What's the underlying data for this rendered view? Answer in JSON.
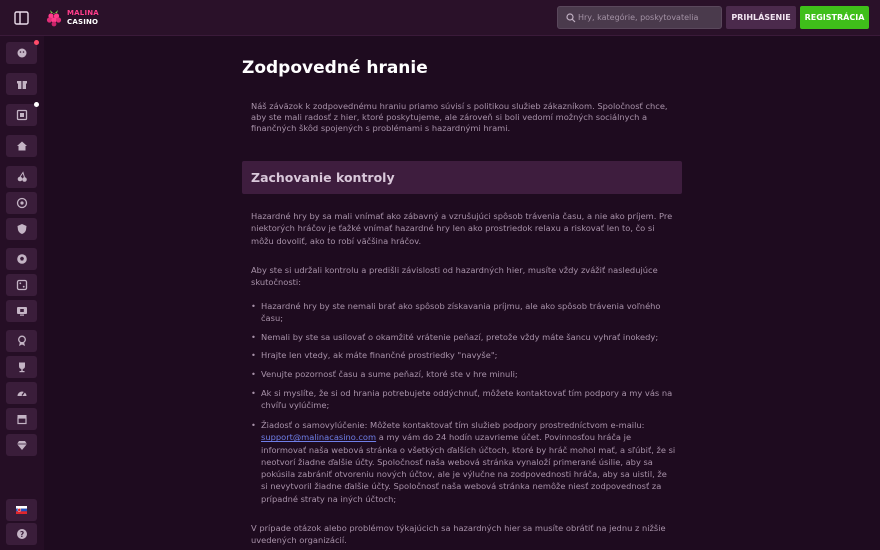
{
  "header": {
    "logo_line1": "MALINA",
    "logo_line2": "CASINO",
    "search_placeholder": "Hry, kategórie, poskytovatelia",
    "login_label": "PRIHLÁSENIE",
    "register_label": "REGISTRÁCIA"
  },
  "sidebar": {
    "items": [
      {
        "icon": "avatar-icon",
        "badge": "red"
      },
      {
        "icon": "gift-icon"
      },
      {
        "icon": "slot-machine-icon",
        "badge": "white"
      },
      {
        "icon": "home-icon"
      },
      {
        "icon": "cherries-icon"
      },
      {
        "icon": "roulette-icon"
      },
      {
        "icon": "shield-icon"
      },
      {
        "icon": "soccer-ball-icon"
      },
      {
        "icon": "dice-icon"
      },
      {
        "icon": "screen-icon"
      },
      {
        "icon": "medal-icon"
      },
      {
        "icon": "trophy-icon"
      },
      {
        "icon": "speedometer-icon"
      },
      {
        "icon": "shop-icon"
      },
      {
        "icon": "diamond-icon"
      },
      {
        "icon": "slovak-flag-icon"
      },
      {
        "icon": "help-icon"
      }
    ]
  },
  "colors": {
    "background": "#1e0b1f",
    "header": "#2a1129",
    "accent_green": "#3fbf1a",
    "logo_pink": "#ff3d8a",
    "link": "#6f7ee8"
  },
  "content": {
    "title": "Zodpovedné hranie",
    "intro": "Náš záväzok k zodpovednému hraniu priamo súvisí s politikou služieb zákazníkom. Spoločnosť chce, aby ste mali radosť z hier, ktoré poskytujeme, ale zároveň si boli vedomí možných sociálnych a finančných škôd spojených s problémami s hazardnými hrami.",
    "section_title": "Zachovanie kontroly",
    "para1": "Hazardné hry by sa mali vnímať ako zábavný a vzrušujúci spôsob trávenia času, a nie ako príjem. Pre niektorých hráčov je ťažké vnímať hazardné hry len ako prostriedok relaxu a riskovať len to, čo si môžu dovoliť, ako to robí väčšina hráčov.",
    "para2": "Aby ste si udržali kontrolu a predišli závislosti od hazardných hier, musíte vždy zvážiť nasledujúce skutočnosti:",
    "bullets": [
      "Hazardné hry by ste nemali brať ako spôsob získavania príjmu, ale ako spôsob trávenia voľného času;",
      "Nemali by ste sa usilovať o okamžité vrátenie peňazí, pretože vždy máte šancu vyhrať inokedy;",
      "Hrajte len vtedy, ak máte finančné prostriedky \"navyše\";",
      "Venujte pozornosť času a sume peňazí, ktoré ste v hre minuli;",
      "Ak si myslíte, že si od hrania potrebujete oddýchnuť, môžete kontaktovať tím podpory a my vás na chvíľu vylúčime;"
    ],
    "self_exclusion_prefix": "Žiadosť o samovylúčenie: Môžete kontaktovať tím služieb podpory prostredníctvom e-mailu:",
    "support_email": "support@malinacasino.com",
    "self_exclusion_suffix": "a my vám do 24 hodín uzavrieme účet. Povinnosťou hráča je informovať naša webová stránka o všetkých ďalších účtoch, ktoré by hráč mohol mať, a sľúbiť, že si neotvorí žiadne ďalšie účty. Spoločnosť naša webová stránka vynaloží primerané úsilie, aby sa pokúsila zabrániť otvoreniu nových účtov, ale je výlučne na zodpovednosti hráča, aby sa uistil, že si nevytvoril žiadne ďalšie účty. Spoločnosť naša webová stránka nemôže niesť zodpovednosť za prípadné straty na iných účtoch;",
    "para3": "V prípade otázok alebo problémov týkajúcich sa hazardných hier sa musíte obrátiť na jednu z nižšie uvedených organizácií."
  }
}
